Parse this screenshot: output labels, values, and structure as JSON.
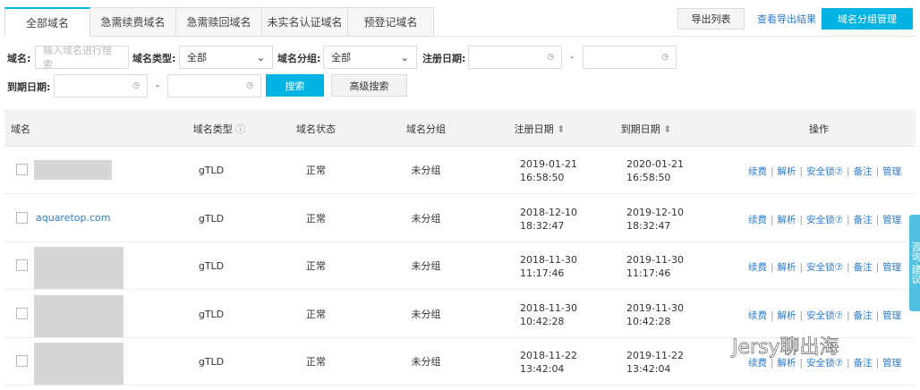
{
  "tabs": [
    "全部域名",
    "急需续费域名",
    "急需赎回域名",
    "未实名认证域名",
    "预登记域名"
  ],
  "toolbar": {
    "export": "导出列表",
    "view_export": "查看导出结果",
    "group_manage": "域名分组管理"
  },
  "filters": {
    "domain_label": "域名:",
    "domain_placeholder": "输入域名进行搜索",
    "type_label": "域名类型:",
    "type_value": "全部",
    "group_label": "域名分组:",
    "group_value": "全部",
    "reg_label": "注册日期:",
    "exp_label": "到期日期:",
    "dash": "-",
    "search": "搜索",
    "advanced": "高级搜索"
  },
  "table": {
    "headers": [
      "域名",
      "域名类型",
      "域名状态",
      "域名分组",
      "注册日期",
      "到期日期",
      "操作"
    ],
    "rows": [
      {
        "domain": "",
        "type": "gTLD",
        "status": "正常",
        "group": "未分组",
        "reg": "2019-01-21",
        "reg_t": "16:58:50",
        "exp": "2020-01-21",
        "exp_t": "16:58:50"
      },
      {
        "domain": "aquaretop.com",
        "type": "gTLD",
        "status": "正常",
        "group": "未分组",
        "reg": "2018-12-10",
        "reg_t": "18:32:47",
        "exp": "2019-12-10",
        "exp_t": "18:32:47"
      },
      {
        "domain": "",
        "type": "gTLD",
        "status": "正常",
        "group": "未分组",
        "reg": "2018-11-30",
        "reg_t": "11:17:46",
        "exp": "2019-11-30",
        "exp_t": "11:17:46"
      },
      {
        "domain": "",
        "type": "gTLD",
        "status": "正常",
        "group": "未分组",
        "reg": "2018-11-30",
        "reg_t": "10:42:28",
        "exp": "2019-11-30",
        "exp_t": "10:42:28"
      },
      {
        "domain": "",
        "type": "gTLD",
        "status": "正常",
        "group": "未分组",
        "reg": "2018-11-22",
        "reg_t": "13:42:04",
        "exp": "2019-11-22",
        "exp_t": "13:42:04"
      }
    ],
    "ops": [
      "续费",
      "解析",
      "安全锁",
      "备注",
      "管理"
    ]
  },
  "side_tab": "咨询·建议",
  "watermark": "Jersy聊出海"
}
